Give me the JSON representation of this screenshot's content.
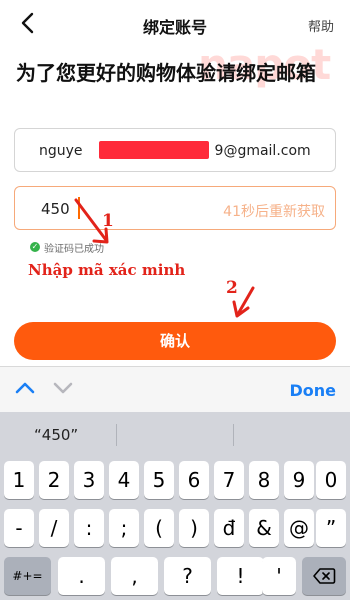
{
  "header": {
    "title": "绑定账号",
    "help_label": "帮助"
  },
  "watermark": "napot",
  "heading": "为了您更好的购物体验请绑定邮箱",
  "email": {
    "value_prefix": "nguye",
    "value_suffix": "9@gmail.com"
  },
  "code": {
    "value": "450",
    "resend_label": "41秒后重新获取"
  },
  "hint": {
    "text": "验证码已成功"
  },
  "annotations": {
    "step1": "1",
    "step1_label": "Nhập mã xác minh",
    "step2": "2",
    "color": "#e2231a"
  },
  "confirm_label": "确认",
  "keyboard_bar": {
    "done_label": "Done"
  },
  "keyboard": {
    "suggestion": "“450”",
    "row1": [
      "1",
      "2",
      "3",
      "4",
      "5",
      "6",
      "7",
      "8",
      "9",
      "0"
    ],
    "row2": [
      "-",
      "/",
      ":",
      ";",
      "(",
      ")",
      "đ",
      "&",
      "@",
      "”"
    ],
    "row3": [
      "#+=",
      ".",
      ",",
      "?",
      "!",
      "'"
    ]
  },
  "colors": {
    "accent": "#ff5a0d",
    "ios_blue": "#1a7ff5"
  }
}
